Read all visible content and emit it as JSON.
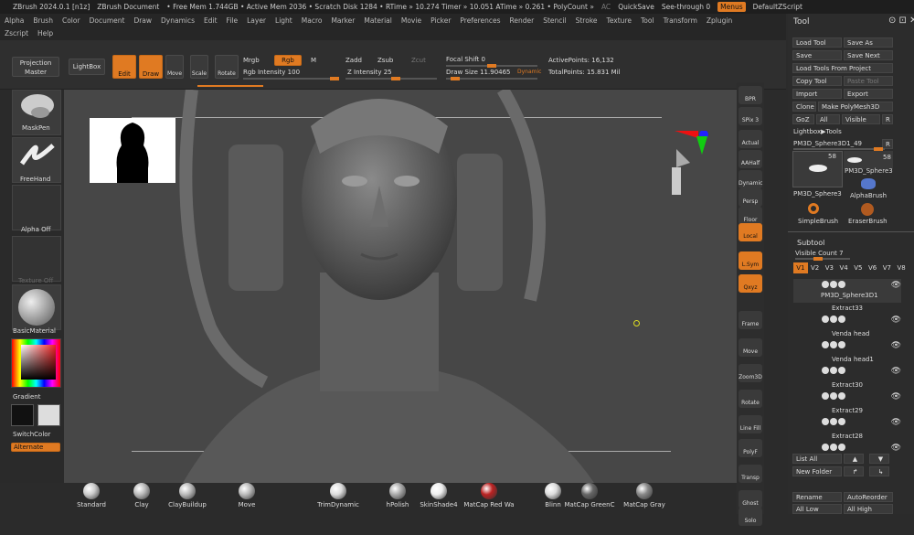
{
  "titlebar": {
    "app": "ZBrush 2024.0.1 [n1z]",
    "doc": "ZBrush Document",
    "stats": "• Free Mem 1.744GB • Active Mem 2036 • Scratch Disk 1284 • RTime » 10.274 Timer » 10.051 ATime » 0.261 • PolyCount »",
    "ac": "AC",
    "quicksave": "QuickSave",
    "seethrough": "See-through 0",
    "menus": "Menus",
    "script": "DefaultZScript"
  },
  "menus": {
    "row1": [
      "Alpha",
      "Brush",
      "Color",
      "Document",
      "Draw",
      "Dynamics",
      "Edit",
      "File",
      "Layer",
      "Light",
      "Macro",
      "Marker",
      "Material",
      "Movie",
      "Picker",
      "Preferences",
      "Render",
      "Stencil",
      "Stroke",
      "Texture",
      "Tool",
      "Transform",
      "Zplugin"
    ],
    "row2": [
      "Zscript",
      "Help"
    ]
  },
  "toolbar": {
    "projection_master": "Projection Master",
    "lightbox": "LightBox",
    "edit": "Edit",
    "draw": "Draw",
    "move": "Move",
    "scale": "Scale",
    "rotate": "Rotate",
    "mrgb": "Mrgb",
    "rgb": "Rgb",
    "m": "M",
    "zadd": "Zadd",
    "zsub": "Zsub",
    "zcut": "Zcut",
    "rgb_intensity": "Rgb Intensity 100",
    "z_intensity": "Z Intensity 25",
    "focal_shift": "Focal Shift 0",
    "draw_size": "Draw Size 11.90465",
    "dynamic": "Dynamic",
    "active_points": "ActivePoints: 16,132",
    "total_points": "TotalPoints: 15.831 Mil"
  },
  "left": {
    "maskpen": "MaskPen",
    "freehand": "FreeHand",
    "alpha_off": "Alpha Off",
    "texture_off": "Texture Off",
    "basic_material": "BasicMaterial",
    "gradient": "Gradient",
    "switch_color": "SwitchColor",
    "alternate": "Alternate"
  },
  "rightstrip": [
    "BPR",
    "SPix 3",
    "Actual",
    "AAHalf",
    "Dynamic",
    "Persp",
    "Floor",
    "Local",
    "L.Sym",
    "Qxyz",
    "Frame",
    "Move",
    "Zoom3D",
    "Rotate",
    "Line Fill",
    "PolyF",
    "Transp",
    "Ghost",
    "Solo"
  ],
  "toolpanel": {
    "title": "Tool",
    "buttons": [
      [
        "Load Tool",
        "Save As"
      ],
      [
        "Save",
        "Save Next"
      ]
    ],
    "load_project": "Load Tools From Project",
    "copy_tool": "Copy Tool",
    "paste_tool": "Paste Tool",
    "import": "Import",
    "export": "Export",
    "clone": "Clone",
    "make_polymesh": "Make PolyMesh3D",
    "goz": "GoZ",
    "all": "All",
    "visible": "Visible",
    "r": "R",
    "lightbox_tools": "Lightbox▶Tools",
    "current_tool": "PM3D_Sphere3D1_49",
    "slot_count": "58",
    "tools": [
      "PM3D_Sphere3",
      "PM3D_Sphere3",
      "AlphaBrush",
      "SimpleBrush",
      "EraserBrush"
    ],
    "subtool_title": "Subtool",
    "visible_count": "Visible Count 7",
    "versions": [
      "V1",
      "V2",
      "V3",
      "V4",
      "V5",
      "V6",
      "V7",
      "V8"
    ],
    "subtools": [
      "PM3D_Sphere3D1",
      "Extract33",
      "Venda head",
      "Venda head1",
      "Extract30",
      "Extract29",
      "Extract28"
    ],
    "list_all": "List All",
    "new_folder": "New Folder",
    "rename": "Rename",
    "auto_reorder": "AutoReorder",
    "all_low": "All Low",
    "all_high": "All High"
  },
  "materials": [
    "Standard",
    "Clay",
    "ClayBuildup",
    "Move",
    "TrimDynamic",
    "hPolish",
    "SkinShade4",
    "MatCap Red Wa",
    "Blinn",
    "MatCap GreenC",
    "MatCap Gray"
  ],
  "colors": {
    "accent": "#e07a22"
  }
}
